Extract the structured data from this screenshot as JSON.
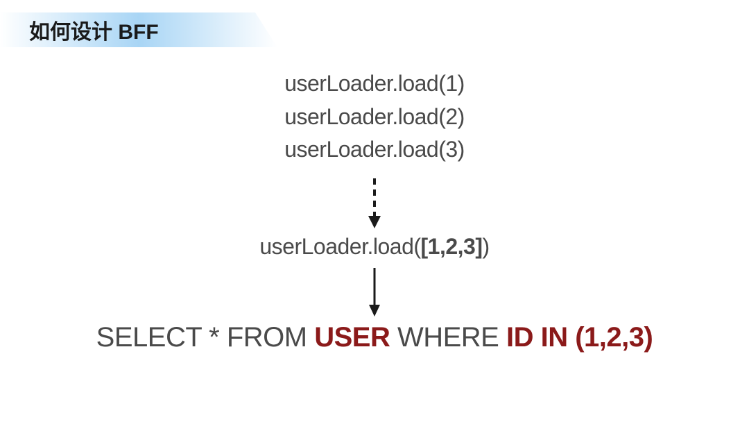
{
  "title": "如何设计 BFF",
  "code": {
    "line1": "userLoader.load(1)",
    "line2": "userLoader.load(2)",
    "line3": "userLoader.load(3)",
    "batchPrefix": "userLoader.load(",
    "batchArg": "[1,2,3]",
    "batchSuffix": ")"
  },
  "sql": {
    "part1": "SELECT * FROM ",
    "highlight1": "USER",
    "part2": " WHERE ",
    "highlight2": "ID IN (1,2,3)"
  }
}
